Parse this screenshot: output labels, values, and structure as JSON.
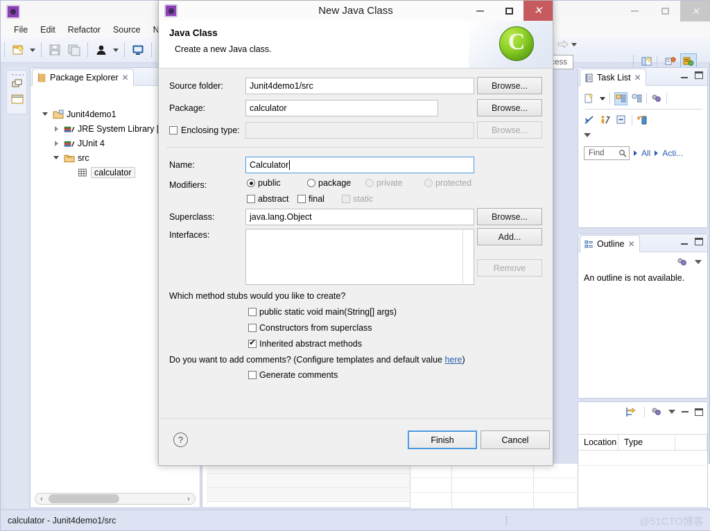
{
  "main_window": {
    "title": "",
    "controls": {
      "minimize": "–",
      "maximize": "□",
      "close": "✕"
    },
    "menu": [
      "File",
      "Edit",
      "Refactor",
      "Source",
      "Navi"
    ],
    "quick_access": {
      "placeholder": "Quick Access",
      "value": "Quick Access"
    }
  },
  "package_explorer": {
    "tab_label": "Package Explorer",
    "tab_close": "✕",
    "tree": [
      {
        "label": "Junit4demo1",
        "depth": 0,
        "state": "expanded",
        "icon": "project-icon"
      },
      {
        "label": "JRE System Library [..",
        "depth": 1,
        "state": "collapsed",
        "icon": "library-icon"
      },
      {
        "label": "JUnit 4",
        "depth": 1,
        "state": "collapsed",
        "icon": "library-icon"
      },
      {
        "label": "src",
        "depth": 1,
        "state": "expanded",
        "icon": "source-folder-icon"
      },
      {
        "label": "calculator",
        "depth": 2,
        "state": "leaf",
        "icon": "package-icon",
        "selected": true
      }
    ]
  },
  "task_list": {
    "tab_label": "Task List",
    "tab_close": "✕",
    "find_placeholder": "Find",
    "find_value": "Find",
    "filter_all": "All",
    "filter_activate": "Acti..."
  },
  "outline": {
    "tab_label": "Outline",
    "tab_close": "✕",
    "message": "An outline is not available."
  },
  "problems_view": {
    "columns": [
      "Location",
      "Type"
    ]
  },
  "status_bar": {
    "text": "calculator - Junit4demo1/src",
    "watermark": "@51CTO博客"
  },
  "dialog": {
    "title": "New Java Class",
    "controls": {
      "minimize": "–",
      "maximize": "□",
      "close": "✕"
    },
    "header": {
      "title": "Java Class",
      "subtitle": "Create a new Java class.",
      "badge_letter": "C"
    },
    "fields": {
      "source_folder": {
        "label": "Source folder:",
        "value": "Junit4demo1/src",
        "button": "Browse..."
      },
      "package": {
        "label": "Package:",
        "value": "calculator",
        "button": "Browse..."
      },
      "enclosing_type": {
        "label": "Enclosing type:",
        "value": "",
        "button": "Browse...",
        "checked": false,
        "enabled": false
      },
      "name": {
        "label": "Name:",
        "value": "Calculator",
        "focused": true
      },
      "modifiers": {
        "label": "Modifiers:",
        "radios": [
          {
            "label": "public",
            "checked": true,
            "enabled": true
          },
          {
            "label": "package",
            "checked": false,
            "enabled": true
          },
          {
            "label": "private",
            "checked": false,
            "enabled": false
          },
          {
            "label": "protected",
            "checked": false,
            "enabled": false
          }
        ],
        "checkboxes": [
          {
            "label": "abstract",
            "checked": false,
            "enabled": true
          },
          {
            "label": "final",
            "checked": false,
            "enabled": true
          },
          {
            "label": "static",
            "checked": false,
            "enabled": false
          }
        ]
      },
      "superclass": {
        "label": "Superclass:",
        "value": "java.lang.Object",
        "button": "Browse..."
      },
      "interfaces": {
        "label": "Interfaces:",
        "value": "",
        "add_button": "Add...",
        "remove_button": "Remove",
        "remove_enabled": false
      }
    },
    "stubs": {
      "question": "Which method stubs would you like to create?",
      "options": [
        {
          "label": "public static void main(String[] args)",
          "checked": false
        },
        {
          "label": "Constructors from superclass",
          "checked": false
        },
        {
          "label": "Inherited abstract methods",
          "checked": true
        }
      ]
    },
    "comments": {
      "question_prefix": "Do you want to add comments? (Configure templates and default value ",
      "link": "here",
      "question_suffix": ")",
      "option": {
        "label": "Generate comments",
        "checked": false
      }
    },
    "footer": {
      "help": "?",
      "finish": "Finish",
      "cancel": "Cancel"
    }
  }
}
